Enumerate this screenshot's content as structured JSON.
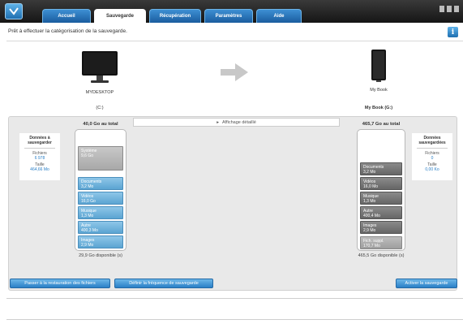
{
  "tabs": [
    {
      "label": "Accueil"
    },
    {
      "label": "Sauvegarde"
    },
    {
      "label": "Récupération"
    },
    {
      "label": "Paramètres"
    },
    {
      "label": "Aide"
    }
  ],
  "status": {
    "text": "Prêt à effectuer la catégorisation de la sauvegarde."
  },
  "source": {
    "name": "MYDESKTOP",
    "drive": "(C:)",
    "total": "40,0 Go au total",
    "available": "29,9 Go disponible (s)",
    "card": {
      "heading": "Données à sauvegarder",
      "files_label": "Fichiers",
      "files_value": "6 978",
      "size_label": "Taille",
      "size_value": "464,66 Mo"
    },
    "categories": [
      {
        "name": "Système",
        "value": "9,6 Go"
      },
      {
        "name": "Documents",
        "value": "3,2 Mo"
      },
      {
        "name": "Vidéos",
        "value": "16,0 Go"
      },
      {
        "name": "Musique",
        "value": "1,3 Mo"
      },
      {
        "name": "Autre",
        "value": "400,3 Mo"
      },
      {
        "name": "Images",
        "value": "2,9 Mo"
      }
    ]
  },
  "detail_toggle": "Affichage détaillé",
  "destination": {
    "name": "My Book",
    "drive": "My Book (G:)",
    "total": "465,7 Go au total",
    "available": "465,5 Go disponible (s)",
    "card": {
      "heading": "Données sauvegardées",
      "files_label": "Fichiers",
      "files_value": "0",
      "size_label": "Taille",
      "size_value": "0,00 Ko"
    },
    "categories": [
      {
        "name": "Documents",
        "value": "3,2 Mo"
      },
      {
        "name": "Vidéos",
        "value": "16,0 Mo"
      },
      {
        "name": "Musique",
        "value": "1,3 Mo"
      },
      {
        "name": "Autre",
        "value": "400,4 Mo"
      },
      {
        "name": "Images",
        "value": "2,9 Mo"
      },
      {
        "name": "Fich. suppl.",
        "value": "170,7 Mo"
      }
    ]
  },
  "buttons": {
    "restore": "Passer à la restauration des fichiers",
    "frequency": "Définir la fréquence de sauvegarde",
    "activate": "Activer la sauvegarde"
  },
  "colors": {
    "accent": "#2a7fc6",
    "category_blue": "#5ba4d2",
    "topbar": "#1f1f1f"
  }
}
